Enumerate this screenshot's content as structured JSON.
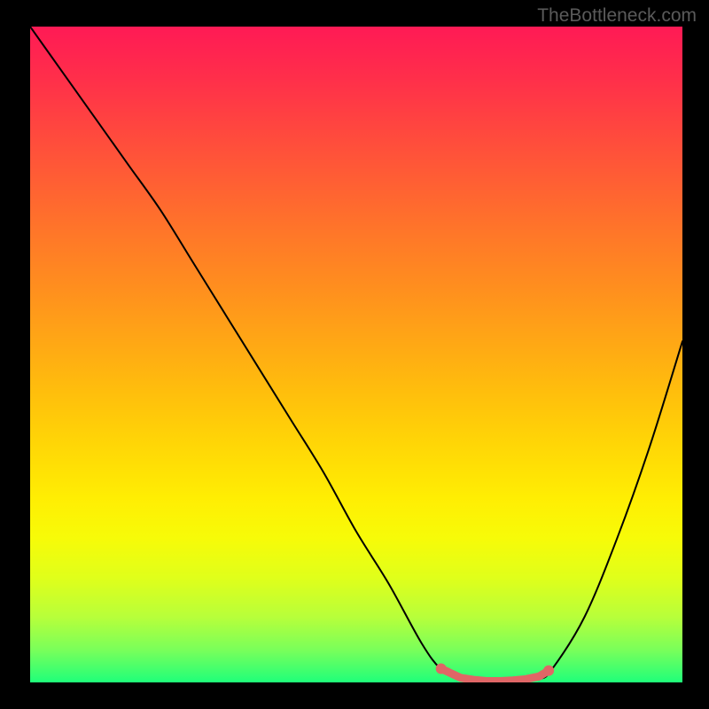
{
  "watermark": "TheBottleneck.com",
  "chart_data": {
    "type": "line",
    "title": "",
    "xlabel": "",
    "ylabel": "",
    "xlim": [
      0,
      100
    ],
    "ylim": [
      0,
      100
    ],
    "series": [
      {
        "name": "bottleneck-curve",
        "x": [
          0,
          5,
          10,
          15,
          20,
          25,
          30,
          35,
          40,
          45,
          50,
          55,
          60,
          63,
          66,
          70,
          74,
          78,
          80,
          85,
          90,
          95,
          100
        ],
        "values": [
          100,
          93,
          86,
          79,
          72,
          64,
          56,
          48,
          40,
          32,
          23,
          15,
          6,
          2,
          0.5,
          0,
          0,
          0.5,
          2,
          10,
          22,
          36,
          52
        ]
      }
    ],
    "markers": {
      "name": "highlight-segment",
      "color": "#e06666",
      "x": [
        63,
        66,
        68,
        70,
        72,
        74,
        76,
        78,
        79.5
      ],
      "values": [
        2.1,
        0.7,
        0.4,
        0.2,
        0.2,
        0.3,
        0.5,
        0.9,
        1.8
      ]
    },
    "gradient_stops": [
      {
        "pos": 0,
        "color": "#ff1a55"
      },
      {
        "pos": 50,
        "color": "#ffbf0c"
      },
      {
        "pos": 80,
        "color": "#ffee03"
      },
      {
        "pos": 100,
        "color": "#1fff7a"
      }
    ]
  }
}
